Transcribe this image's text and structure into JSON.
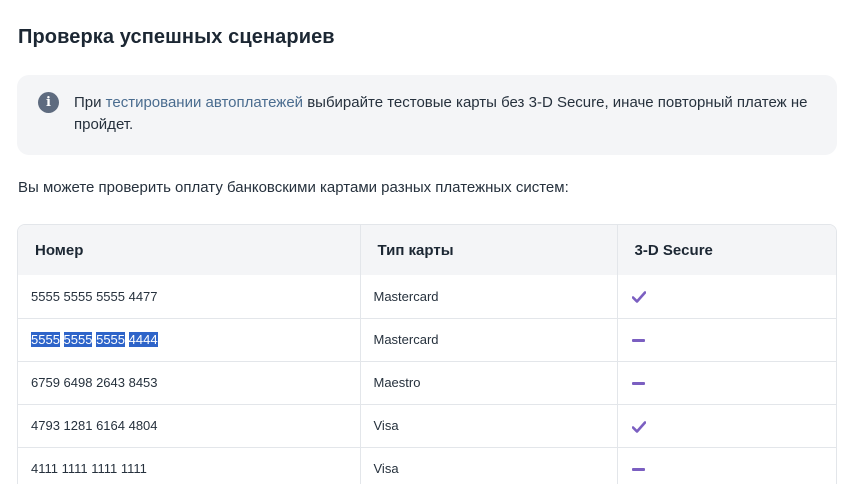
{
  "page": {
    "title": "Проверка успешных сценариев",
    "notice": {
      "prefix": "При ",
      "link": "тестировании автоплатежей",
      "suffix": " выбирайте тестовые карты без 3-D Secure, иначе повторный платеж не пройдет."
    },
    "intro": "Вы можете проверить оплату банковскими картами разных платежных систем:"
  },
  "table": {
    "headers": [
      "Номер",
      "Тип карты",
      "3-D Secure"
    ],
    "rows": [
      {
        "number": "5555 5555 5555 4477",
        "type": "Mastercard",
        "secure": "check-icon"
      },
      {
        "number": "5555 5555 5555 4444",
        "number_parts": [
          "5555",
          "5555",
          "5555",
          "4444"
        ],
        "type": "Mastercard",
        "secure": "dash-icon",
        "selected": true
      },
      {
        "number": "6759 6498 2643 8453",
        "type": "Maestro",
        "secure": "dash-icon"
      },
      {
        "number": "4793 1281 6164 4804",
        "type": "Visa",
        "secure": "check-icon"
      },
      {
        "number": "4111 1111 1111 1111",
        "type": "Visa",
        "secure": "dash-icon"
      }
    ]
  },
  "colors": {
    "accent": "#7b5fc1",
    "selection": "#2e64c9",
    "link": "#4a6c8f",
    "panel": "#f4f5f7"
  }
}
